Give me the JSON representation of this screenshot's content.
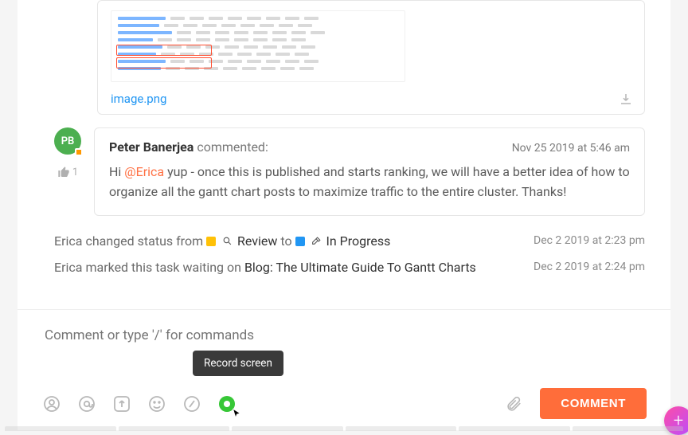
{
  "attachment": {
    "filename": "image.png"
  },
  "comment": {
    "avatar_initials": "PB",
    "author": "Peter Banerjea",
    "verb": "commented:",
    "timestamp": "Nov 25 2019 at 5:46 am",
    "body_prefix": "Hi ",
    "mention": "@Erica",
    "body_suffix": " yup - once this is published and starts ranking, we will have a better idea of how to organize all the gantt chart posts to maximize traffic to the entire cluster. Thanks!",
    "like_count": "1"
  },
  "activity1": {
    "actor": "Erica",
    "text_prefix": " changed status from ",
    "status_from": "Review",
    "mid": " to ",
    "status_to": "In Progress",
    "timestamp": "Dec 2 2019 at 2:23 pm"
  },
  "activity2": {
    "actor": "Erica",
    "text_prefix": " marked this task waiting on ",
    "task": "Blog: The Ultimate Guide To Gantt Charts",
    "timestamp": "Dec 2 2019 at 2:24 pm"
  },
  "input": {
    "placeholder": "Comment or type '/' for commands"
  },
  "tooltip": {
    "record": "Record screen"
  },
  "buttons": {
    "comment": "COMMENT"
  }
}
